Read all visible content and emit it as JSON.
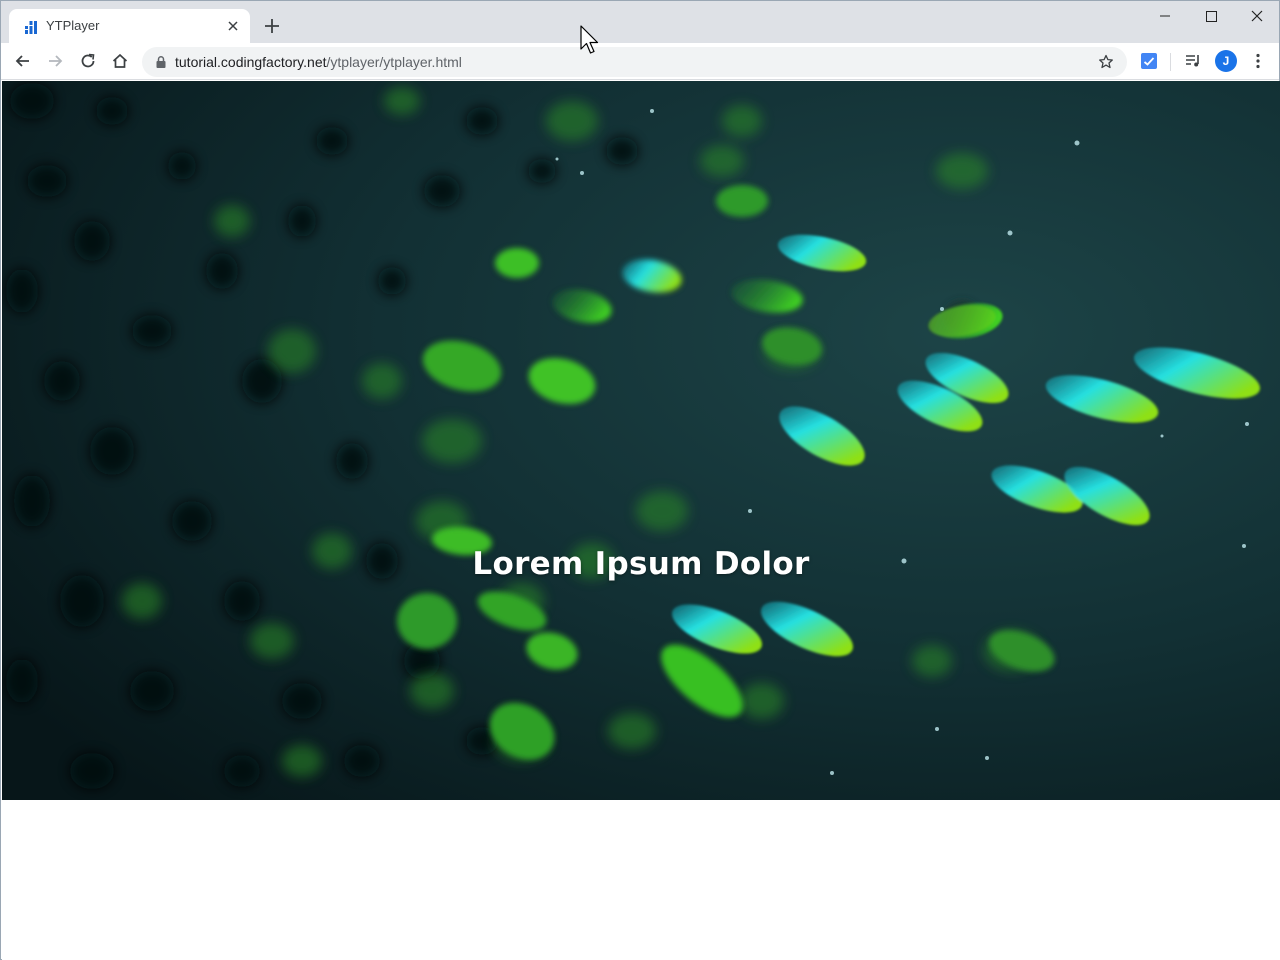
{
  "browser": {
    "tab": {
      "title": "YTPlayer",
      "favicon": "bar-chart-favicon",
      "close_icon": "close-icon"
    },
    "new_tab_icon": "plus-icon",
    "window_controls": [
      "minimize-icon",
      "maximize-icon",
      "close-icon"
    ],
    "toolbar": {
      "back_icon": "arrow-left-icon",
      "forward_icon": "arrow-right-icon",
      "reload_icon": "reload-icon",
      "home_icon": "home-icon"
    },
    "address": {
      "host": "tutorial.codingfactory.net",
      "path": "/ytplayer/ytplayer.html",
      "secure_icon": "lock-icon",
      "bookmark_icon": "star-icon"
    },
    "extensions": [
      "checkmark-extension-icon",
      "media-queue-icon"
    ],
    "profile": {
      "initial": "J",
      "color": "#1a73e8"
    },
    "menu_icon": "kebab-menu-icon"
  },
  "page": {
    "hero": {
      "title": "Lorem Ipsum Dolor",
      "background_colors": [
        "#0d2226",
        "#16383a",
        "#22c0d8",
        "#8ee21a"
      ]
    }
  }
}
